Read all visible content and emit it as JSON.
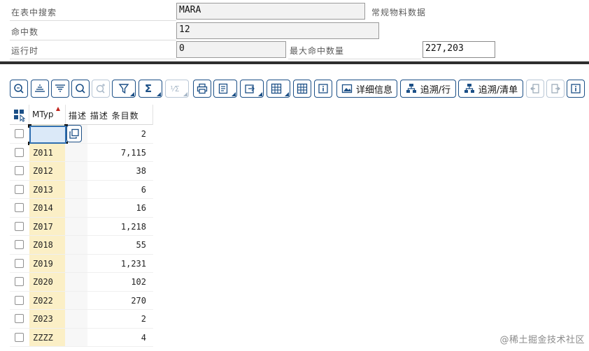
{
  "header": {
    "search_label": "在表中搜索",
    "search_value": "MARA",
    "table_desc": "常规物料数据",
    "hits_label": "命中数",
    "hits_value": "12",
    "runtime_label": "运行时",
    "runtime_value": "0",
    "max_hits_label": "最大命中数量",
    "max_hits_value": "227,203"
  },
  "toolbar": {
    "detail_label": "详细信息",
    "trace_row_label": "追溯/行",
    "trace_list_label": "追溯/清单"
  },
  "grid": {
    "col_mtyp": "MTyp",
    "col_rest": "描述 描述 条目数",
    "rows": [
      {
        "mtyp": "",
        "count": "2"
      },
      {
        "mtyp": "Z011",
        "count": "7,115"
      },
      {
        "mtyp": "Z012",
        "count": "38"
      },
      {
        "mtyp": "Z013",
        "count": "6"
      },
      {
        "mtyp": "Z014",
        "count": "16"
      },
      {
        "mtyp": "Z017",
        "count": "1,218"
      },
      {
        "mtyp": "Z018",
        "count": "55"
      },
      {
        "mtyp": "Z019",
        "count": "1,231"
      },
      {
        "mtyp": "Z020",
        "count": "102"
      },
      {
        "mtyp": "Z022",
        "count": "270"
      },
      {
        "mtyp": "Z023",
        "count": "2"
      },
      {
        "mtyp": "ZZZZ",
        "count": "4"
      }
    ]
  },
  "watermark": "@稀土掘金技术社区",
  "colors": {
    "accent": "#1b4f86",
    "key_column": "#fbefc6",
    "focus": "#2f6eb0"
  }
}
